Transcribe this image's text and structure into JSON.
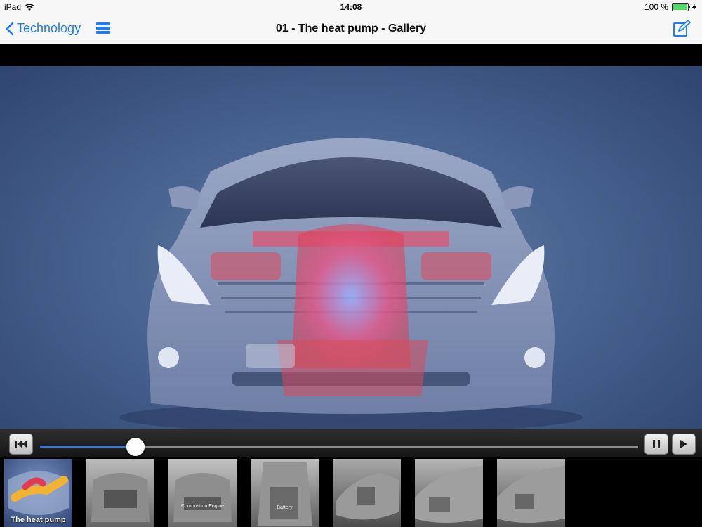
{
  "status": {
    "device": "iPad",
    "time": "14:08",
    "battery": "100 %"
  },
  "nav": {
    "back_label": "Technology",
    "title": "01 - The heat pump - Gallery"
  },
  "player": {
    "progress": 0.16
  },
  "thumbnails": [
    {
      "caption": "The heat pump"
    },
    {
      "caption": ""
    },
    {
      "caption": "Combustion Engine"
    },
    {
      "caption": "Battery"
    },
    {
      "caption": ""
    },
    {
      "caption": ""
    },
    {
      "caption": ""
    }
  ],
  "colors": {
    "accent": "#1f7bf6",
    "battery": "#4cd964",
    "background": "#4a6491"
  }
}
